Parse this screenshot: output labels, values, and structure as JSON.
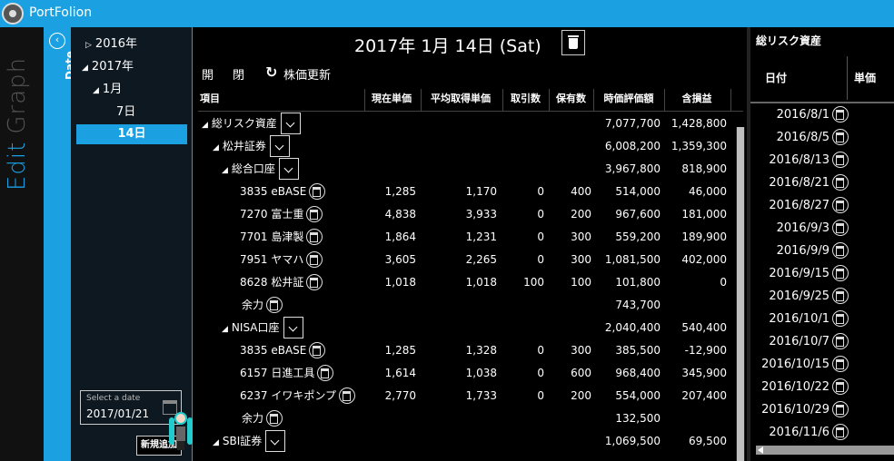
{
  "app": {
    "title": "PortFolion"
  },
  "modebar": {
    "edit": "Edit",
    "graph": "Graph"
  },
  "datebar": {
    "label": "Date",
    "toggle_icon": "chevron-left-icon"
  },
  "tree": {
    "items": [
      "2016年",
      "2017年",
      "1月",
      "7日",
      "14日"
    ],
    "selected": "14日"
  },
  "date_picker": {
    "placeholder": "Select a date",
    "value": "2017/01/21"
  },
  "add_button": {
    "label": "新規追加"
  },
  "main": {
    "date_title": "2017年 1月 14日 (Sat)",
    "toolbar": {
      "open": "開",
      "close": "閉",
      "refresh": "株価更新"
    },
    "headers": [
      "項目",
      "現在単価",
      "平均取得単価",
      "取引数",
      "保有数",
      "時価評価額",
      "含損益"
    ],
    "rows": [
      {
        "name": "総リスク資産",
        "dropdown": true,
        "value": "7,077,700",
        "pl": "1,428,800"
      },
      {
        "name": "松井証券",
        "dropdown": true,
        "value": "6,008,200",
        "pl": "1,359,300"
      },
      {
        "name": "総合口座",
        "dropdown": true,
        "value": "3,967,800",
        "pl": "818,900"
      },
      {
        "name": "3835 eBASE",
        "price": "1,285",
        "avg": "1,170",
        "trade": "0",
        "hold": "400",
        "value": "514,000",
        "pl": "46,000"
      },
      {
        "name": "7270 富士重",
        "price": "4,838",
        "avg": "3,933",
        "trade": "0",
        "hold": "200",
        "value": "967,600",
        "pl": "181,000"
      },
      {
        "name": "7701 島津製",
        "price": "1,864",
        "avg": "1,231",
        "trade": "0",
        "hold": "300",
        "value": "559,200",
        "pl": "189,900"
      },
      {
        "name": "7951 ヤマハ",
        "price": "3,605",
        "avg": "2,265",
        "trade": "0",
        "hold": "300",
        "value": "1,081,500",
        "pl": "402,000"
      },
      {
        "name": "8628 松井証",
        "price": "1,018",
        "avg": "1,018",
        "trade": "100",
        "hold": "100",
        "value": "101,800",
        "pl": "0"
      },
      {
        "name": "余力",
        "value": "743,700"
      },
      {
        "name": "NISA口座",
        "dropdown": true,
        "value": "2,040,400",
        "pl": "540,400"
      },
      {
        "name": "3835 eBASE",
        "price": "1,285",
        "avg": "1,328",
        "trade": "0",
        "hold": "300",
        "value": "385,500",
        "pl": "-12,900"
      },
      {
        "name": "6157 日進工具",
        "price": "1,614",
        "avg": "1,038",
        "trade": "0",
        "hold": "600",
        "value": "968,400",
        "pl": "345,900"
      },
      {
        "name": "6237 イワキポンプ",
        "price": "2,770",
        "avg": "1,733",
        "trade": "0",
        "hold": "200",
        "value": "554,000",
        "pl": "207,400"
      },
      {
        "name": "余力",
        "value": "132,500"
      },
      {
        "name": "SBI証券",
        "dropdown": true,
        "value": "1,069,500",
        "pl": "69,500"
      }
    ]
  },
  "right_panel": {
    "title": "総リスク資産",
    "headers": [
      "日付",
      "単価"
    ],
    "dates": [
      "2016/8/1",
      "2016/8/5",
      "2016/8/13",
      "2016/8/21",
      "2016/8/27",
      "2016/9/3",
      "2016/9/9",
      "2016/9/15",
      "2016/9/25",
      "2016/10/1",
      "2016/10/7",
      "2016/10/15",
      "2016/10/22",
      "2016/10/29",
      "2016/11/6"
    ]
  }
}
